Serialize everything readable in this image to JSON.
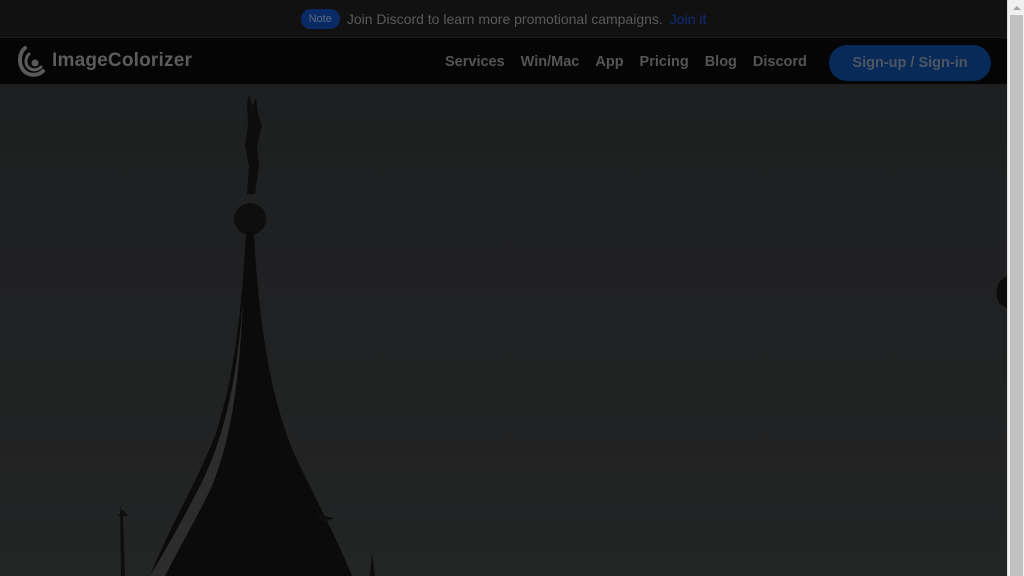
{
  "announcement": {
    "badge": "Note",
    "text": "Join Discord to learn more promotional campaigns.",
    "link": "Join it"
  },
  "header": {
    "brand": "ImageColorizer",
    "nav": [
      {
        "label": "Services"
      },
      {
        "label": "Win/Mac"
      },
      {
        "label": "App"
      },
      {
        "label": "Pricing"
      },
      {
        "label": "Blog"
      },
      {
        "label": "Discord"
      }
    ],
    "signin_label": "Sign-up / Sign-in"
  },
  "hero": {
    "image_subject": "spire-silhouette-icon"
  },
  "colors": {
    "brand_blue": "#072a58",
    "link_blue": "#142a7a",
    "overlay_dark": "#1e1f20"
  }
}
